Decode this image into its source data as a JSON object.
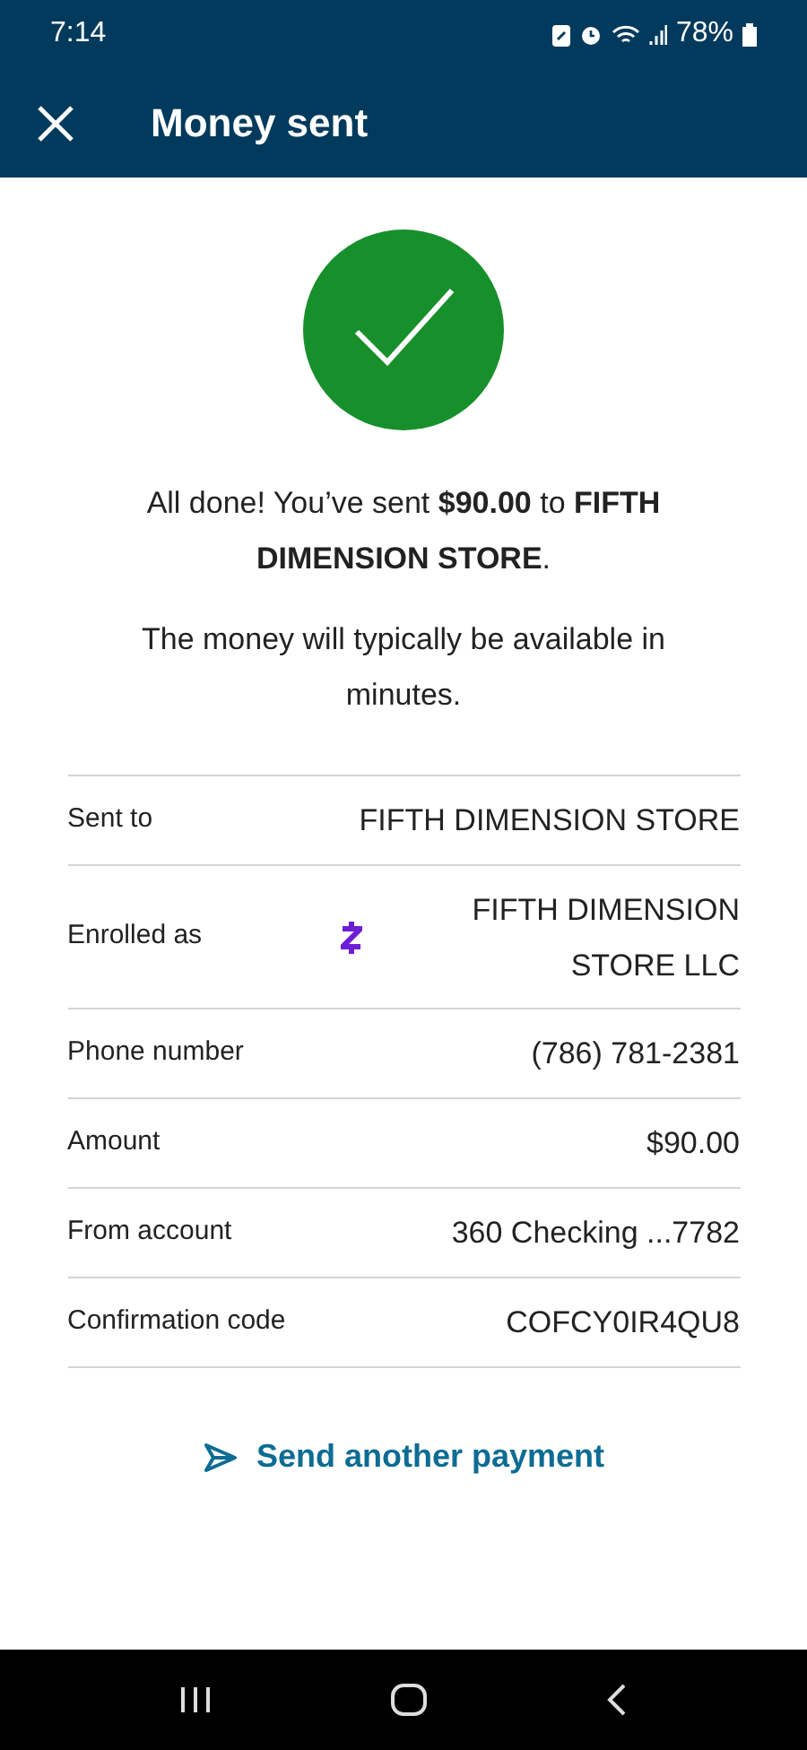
{
  "status_bar": {
    "time": "7:14",
    "battery": "78%"
  },
  "header": {
    "title": "Money sent"
  },
  "message": "All done! You’ve sent **$90.00** to **FIFTH DIMENSION STORE**.",
  "note": "The money will typically be available in minutes.",
  "details": [
    {
      "kind": "plain",
      "label": "Sent to",
      "value": "FIFTH DIMENSION STORE"
    },
    {
      "kind": "with_icon",
      "label": "Enrolled as",
      "value": "FIFTH DIMENSION STORE LLC"
    },
    {
      "kind": "plain",
      "label": "Phone number",
      "value": "(786) 781-2381"
    },
    {
      "kind": "plain",
      "label": "Amount",
      "value": "$90.00"
    },
    {
      "kind": "plain",
      "label": "From account",
      "value": "360 Checking ...7782"
    },
    {
      "kind": "plain",
      "label": "Confirmation code",
      "value": "COFCY0IR4QU8"
    }
  ],
  "action": {
    "label": "Send another payment"
  }
}
